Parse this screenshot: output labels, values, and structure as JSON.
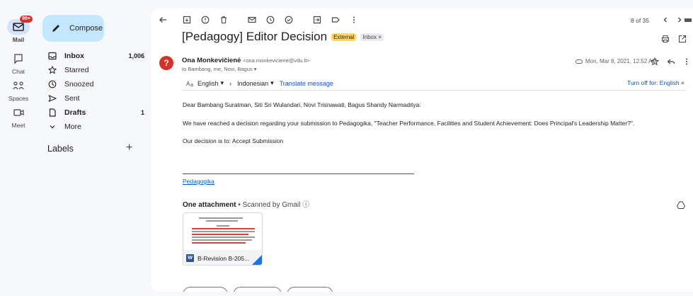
{
  "rail": {
    "mail": {
      "label": "Mail",
      "badge": "99+"
    },
    "chat": {
      "label": "Chat"
    },
    "spaces": {
      "label": "Spaces"
    },
    "meet": {
      "label": "Meet"
    }
  },
  "compose_label": "Compose",
  "nav": [
    {
      "label": "Inbox",
      "count": "1,006",
      "bold": true,
      "icon": "inbox-icon"
    },
    {
      "label": "Starred",
      "count": "",
      "icon": "star-icon"
    },
    {
      "label": "Snoozed",
      "count": "",
      "icon": "clock-icon"
    },
    {
      "label": "Sent",
      "count": "",
      "icon": "send-icon"
    },
    {
      "label": "Drafts",
      "count": "1",
      "bold": true,
      "icon": "draft-icon"
    },
    {
      "label": "More",
      "count": "",
      "icon": "chevron-down-icon"
    }
  ],
  "labels_heading": "Labels",
  "message": {
    "subject": "[Pedagogy] Editor Decision",
    "chip_external": "External",
    "chip_inbox": "Inbox ×",
    "pager": "8 of 35",
    "avatar_letter": "?",
    "sender_name": "Ona Monkevičienė",
    "sender_email": "<ona.monkeviciene@vdu.lt>",
    "to_line": "to Bambang, me, Novi, Bagus ▾",
    "date": "Mon, Mar 8, 2021, 12:52 AM",
    "translate": {
      "from": "English",
      "to": "Indonesian",
      "action": "Translate message",
      "turn_off": "Turn off for: English"
    },
    "body": [
      "Dear Bambang Suratman, Siti Sri Wulandari, Novi Trisnawati, Bagus Shandy Narmaditya:",
      "We have reached a decision regarding your submission to Pedagogika, \"Teacher Performance, Facilities and Student Achievement: Does Principal's Leadership Matter?\".",
      "Our decision is to: Accept Submission"
    ],
    "signature_link": "Pedagogika",
    "attachments_heading": "One attachment",
    "scanned_text": "Scanned by Gmail",
    "attachment_name": "B-Revision B-205..."
  },
  "colors": {
    "accent": "#0b57d0",
    "compose_bg": "#c2e7ff",
    "external_chip": "#fdd663",
    "avatar": "#d93025"
  }
}
